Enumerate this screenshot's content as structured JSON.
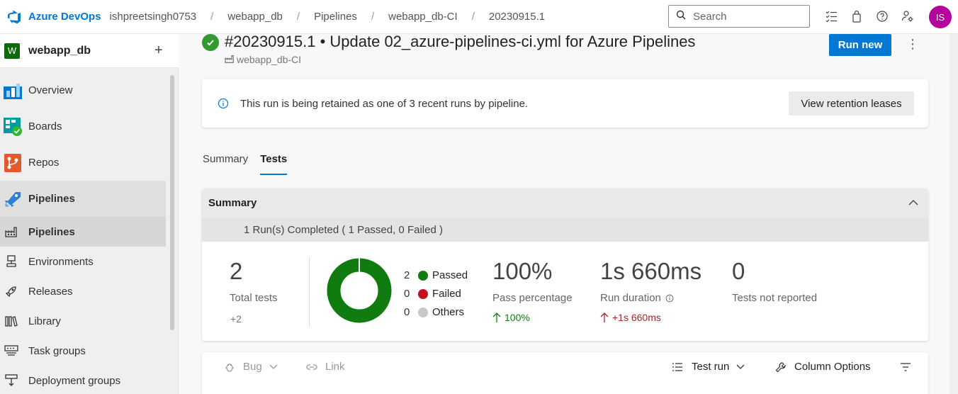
{
  "topbar": {
    "brand": "Azure DevOps",
    "breadcrumbs": [
      "ishpreetsingh0753",
      "webapp_db",
      "Pipelines",
      "webapp_db-CI",
      "20230915.1"
    ],
    "search_placeholder": "Search",
    "avatar_initials": "IS"
  },
  "sidebar": {
    "project_badge": "W",
    "project_name": "webapp_db",
    "add_symbol": "+",
    "items": [
      {
        "label": "Overview"
      },
      {
        "label": "Boards"
      },
      {
        "label": "Repos"
      },
      {
        "label": "Pipelines"
      },
      {
        "label": "Pipelines"
      },
      {
        "label": "Environments"
      },
      {
        "label": "Releases"
      },
      {
        "label": "Library"
      },
      {
        "label": "Task groups"
      },
      {
        "label": "Deployment groups"
      }
    ]
  },
  "run": {
    "title": "#20230915.1 • Update 02_azure-pipelines-ci.yml for Azure Pipelines",
    "pipeline": "webapp_db-CI",
    "run_new_label": "Run new",
    "more_symbol": "⋮"
  },
  "banner": {
    "text": "This run is being retained as one of 3 recent runs by pipeline.",
    "button_label": "View retention leases"
  },
  "tabs": [
    {
      "label": "Summary"
    },
    {
      "label": "Tests",
      "active": true
    }
  ],
  "summary": {
    "header": "Summary",
    "runs_completed": "1 Run(s) Completed ( 1 Passed, 0 Failed )",
    "total_tests": {
      "value": "2",
      "label": "Total tests",
      "delta": "+2"
    },
    "legend": [
      {
        "count": "2",
        "label": "Passed",
        "color": "#107c10"
      },
      {
        "count": "0",
        "label": "Failed",
        "color": "#c50f1f"
      },
      {
        "count": "0",
        "label": "Others",
        "color": "#c8c8c8"
      }
    ],
    "pass_percentage": {
      "value": "100%",
      "label": "Pass percentage",
      "delta": "100%"
    },
    "run_duration": {
      "value": "1s 660ms",
      "label": "Run duration",
      "delta": "+1s 660ms"
    },
    "not_reported": {
      "value": "0",
      "label": "Tests not reported"
    }
  },
  "toolbar": {
    "bug_label": "Bug",
    "link_label": "Link",
    "test_run_label": "Test run",
    "column_options_label": "Column Options"
  },
  "colors": {
    "accent": "#0078d4",
    "success": "#107c10",
    "failure": "#c50f1f",
    "avatar": "#b4009e"
  }
}
